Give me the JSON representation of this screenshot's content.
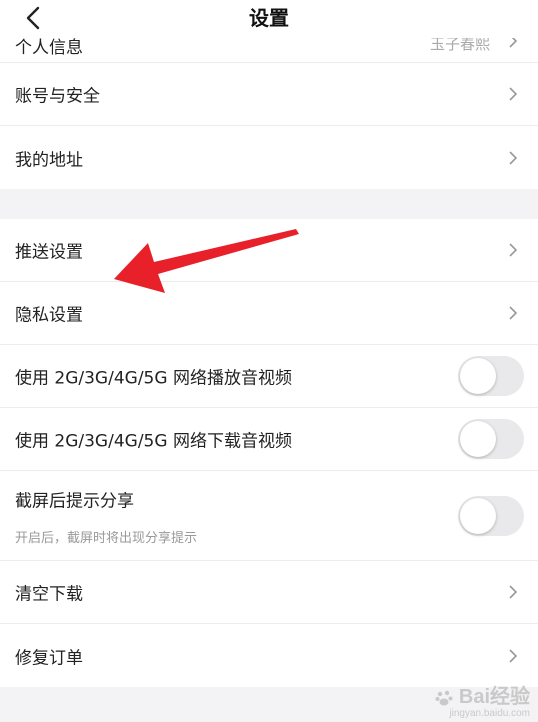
{
  "header": {
    "title": "设置"
  },
  "group1": {
    "personal_info": {
      "label": "个人信息",
      "value": "玉子春熙"
    },
    "account_security": {
      "label": "账号与安全"
    },
    "my_address": {
      "label": "我的地址"
    }
  },
  "group2": {
    "push_settings": {
      "label": "推送设置"
    },
    "privacy_settings": {
      "label": "隐私设置"
    },
    "play_on_mobile": {
      "label": "使用 2G/3G/4G/5G 网络播放音视频",
      "enabled": false
    },
    "download_on_mobile": {
      "label": "使用 2G/3G/4G/5G 网络下载音视频",
      "enabled": false
    },
    "screenshot_share": {
      "label": "截屏后提示分享",
      "hint": "开启后，截屏时将出现分享提示",
      "enabled": false
    },
    "clear_downloads": {
      "label": "清空下载"
    },
    "repair_orders": {
      "label": "修复订单"
    }
  },
  "annotation": {
    "arrow_color": "#e8202a"
  },
  "watermark": {
    "text": "Bai经验",
    "url": "jingyan.baidu.com"
  },
  "icons": [
    "back-icon",
    "chevron-right-icon",
    "red-arrow-annotation",
    "baidu-paw-icon"
  ]
}
